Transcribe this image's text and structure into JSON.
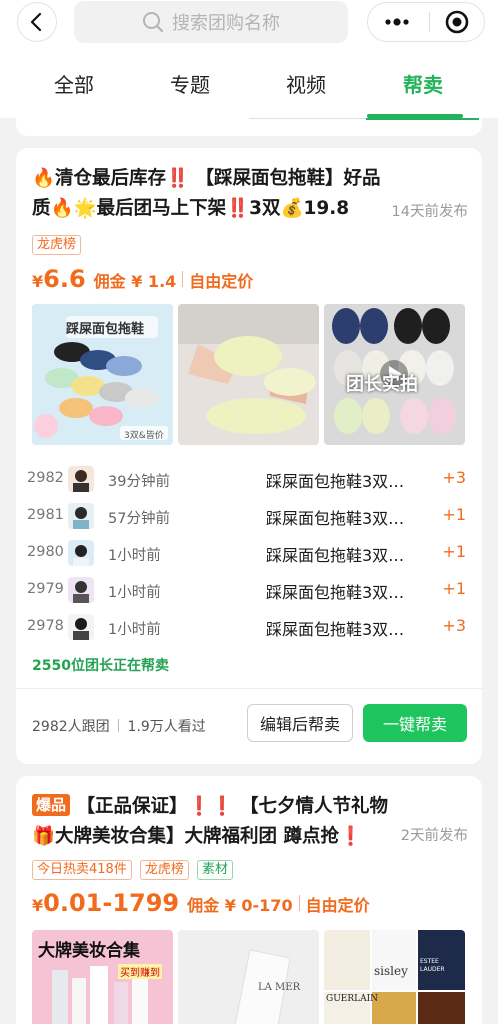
{
  "search": {
    "placeholder": "搜索团购名称"
  },
  "tabs": [
    {
      "label": "全部"
    },
    {
      "label": "专题"
    },
    {
      "label": "视频"
    },
    {
      "label": "帮卖"
    }
  ],
  "accent_color": "#23b35a",
  "price_color": "#f26b1d",
  "card1": {
    "title": "🔥清仓最后库存‼️ 【踩屎面包拖鞋】好品质🔥🌟最后团马上下架‼️3双💰19.8",
    "ago": "14天前发布",
    "tags": [
      "龙虎榜"
    ],
    "currency": "¥",
    "price": "6.6",
    "commission": "佣金 ¥ 1.4",
    "pricing_mode": "自由定价",
    "thumb1_text": "踩屎面包拖鞋",
    "thumb1_sub": "3双&皆价",
    "thumb3_text": "团长实拍",
    "rows": [
      {
        "num": "2982",
        "time": "39分钟前",
        "product": "踩屎面包拖鞋3双…",
        "plus": "+3"
      },
      {
        "num": "2981",
        "time": "57分钟前",
        "product": "踩屎面包拖鞋3双…",
        "plus": "+1"
      },
      {
        "num": "2980",
        "time": "1小时前",
        "product": "踩屎面包拖鞋3双…",
        "plus": "+1"
      },
      {
        "num": "2979",
        "time": "1小时前",
        "product": "踩屎面包拖鞋3双…",
        "plus": "+1"
      },
      {
        "num": "2978",
        "time": "1小时前",
        "product": "踩屎面包拖鞋3双…",
        "plus": "+3"
      }
    ],
    "helping": "2550位团长正在帮卖",
    "followers": "2982人跟团",
    "views": "1.9万人看过",
    "edit_label": "编辑后帮卖",
    "help_label": "一键帮卖"
  },
  "card2": {
    "badge": "爆品",
    "title": "【正品保证】❗❗ 【七夕情人节礼物🎁大牌美妆合集】大牌福利团 蹲点抢❗",
    "ago": "2天前发布",
    "tags": [
      "今日热卖418件",
      "龙虎榜",
      "素材"
    ],
    "currency": "¥",
    "price": "0.01-1799",
    "commission": "佣金 ¥ 0-170",
    "pricing_mode": "自由定价",
    "thumb1_text": "大牌美妆合集",
    "thumb1_sub": "买到赚到",
    "thumb2_brand": "LA MER",
    "thumb3_brands": [
      "sisley",
      "ESTEE LAUDER",
      "GUERLAIN"
    ]
  }
}
